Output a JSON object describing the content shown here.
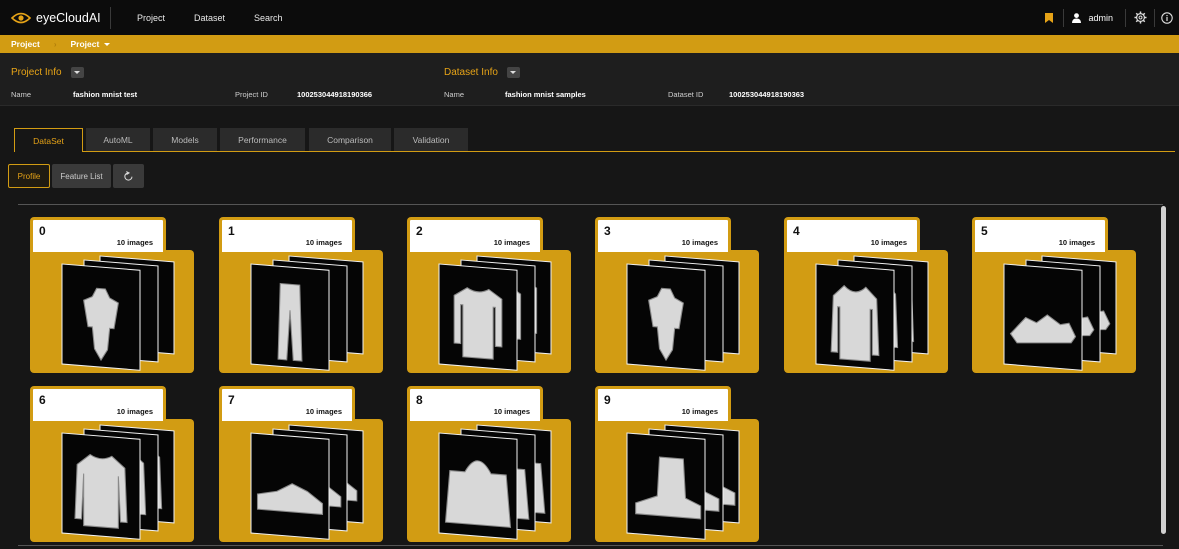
{
  "app": {
    "logo_text": "eyeCloudAI",
    "logo_icon": "eye-logo-icon"
  },
  "topnav": [
    {
      "label": "Project"
    },
    {
      "label": "Dataset"
    },
    {
      "label": "Search"
    }
  ],
  "topright": {
    "bookmark_icon": "bookmark-icon",
    "user_icon": "user-icon",
    "user_name": "admin",
    "settings_icon": "gear-icon",
    "info_icon": "info-icon"
  },
  "breadcrumb": [
    "Project",
    "Project"
  ],
  "project_info": {
    "title": "Project Info",
    "name_label": "Name",
    "name": "fashion mnist test",
    "id_label": "Project ID",
    "id": "100253044918190366"
  },
  "dataset_info": {
    "title": "Dataset Info",
    "name_label": "Name",
    "name": "fashion mnist samples",
    "id_label": "Dataset ID",
    "id": "100253044918190363"
  },
  "tabs": [
    {
      "label": "DataSet",
      "active": true
    },
    {
      "label": "AutoML"
    },
    {
      "label": "Models"
    },
    {
      "label": "Performance"
    },
    {
      "label": "Comparison"
    },
    {
      "label": "Validation"
    }
  ],
  "subbuttons": {
    "profile": "Profile",
    "feature_list": "Feature List",
    "refresh_icon": "refresh-icon"
  },
  "accent_color": "#d29c13",
  "classes": [
    {
      "label": "0",
      "count": "10 images",
      "item": "dress"
    },
    {
      "label": "1",
      "count": "10 images",
      "item": "trouser"
    },
    {
      "label": "2",
      "count": "10 images",
      "item": "pullover"
    },
    {
      "label": "3",
      "count": "10 images",
      "item": "dress"
    },
    {
      "label": "4",
      "count": "10 images",
      "item": "coat"
    },
    {
      "label": "5",
      "count": "10 images",
      "item": "sandal"
    },
    {
      "label": "6",
      "count": "10 images",
      "item": "shirt"
    },
    {
      "label": "7",
      "count": "10 images",
      "item": "sneaker"
    },
    {
      "label": "8",
      "count": "10 images",
      "item": "bag"
    },
    {
      "label": "9",
      "count": "10 images",
      "item": "ankle-boot"
    }
  ]
}
